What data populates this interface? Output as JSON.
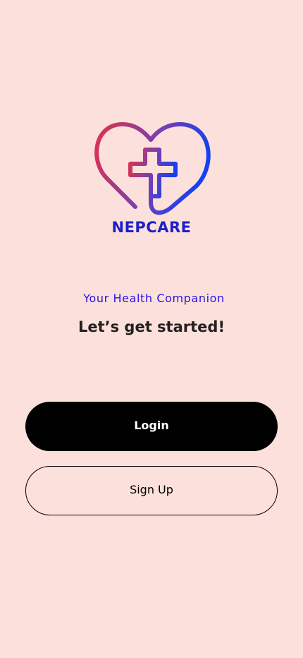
{
  "brand": {
    "name": "NEPCARE",
    "color": "#1f1fc8",
    "logo_icon": "heart-cross-icon",
    "logo_gradient": [
      "#e0334a",
      "#1640f0"
    ]
  },
  "tagline": "Your Health Companion",
  "heading": "Let’s get started!",
  "buttons": {
    "login": "Login",
    "signup": "Sign Up"
  },
  "colors": {
    "background": "#fbe0db",
    "tagline": "#2a12e6",
    "heading": "#231f1f",
    "primary_button": "#000000"
  }
}
